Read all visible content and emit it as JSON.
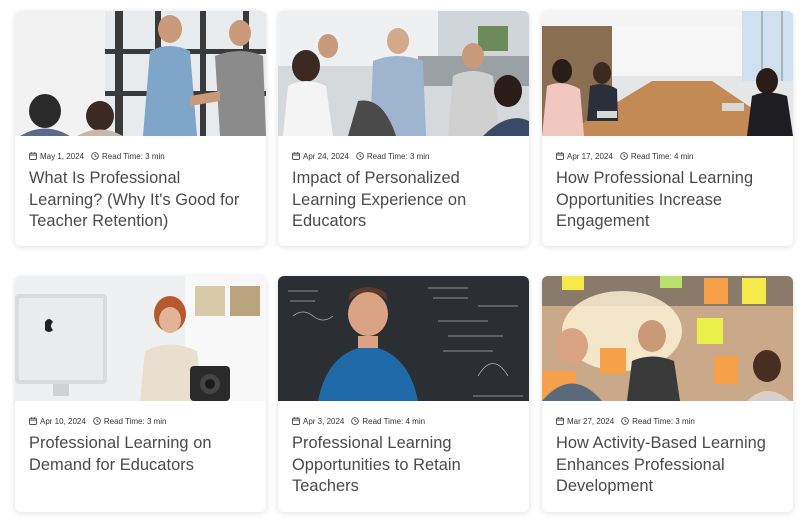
{
  "posts": [
    {
      "date": "May 1, 2024",
      "read_time": "Read Time: 3 min",
      "title": "What Is Professional Learning? (Why It's Good for Teacher Retention)",
      "image": "two-men-shaking-hands-office-photo"
    },
    {
      "date": "Apr 24, 2024",
      "read_time": "Read Time: 3 min",
      "title": "Impact of Personalized Learning Experience on Educators",
      "image": "group-discussion-office-photo"
    },
    {
      "date": "Apr 17, 2024",
      "read_time": "Read Time: 4 min",
      "title": "How Professional Learning Opportunities Increase Engagement",
      "image": "conference-room-meeting-photo"
    },
    {
      "date": "Apr 10, 2024",
      "read_time": "Read Time: 3 min",
      "title": "Professional Learning on Demand for Educators",
      "image": "woman-at-computer-photo"
    },
    {
      "date": "Apr 3, 2024",
      "read_time": "Read Time: 4 min",
      "title": "Professional Learning Opportunities to Retain Teachers",
      "image": "man-at-chalkboard-photo"
    },
    {
      "date": "Mar 27, 2024",
      "read_time": "Read Time: 3 min",
      "title": "How Activity-Based Learning Enhances Professional Development",
      "image": "sticky-notes-brainstorm-photo"
    }
  ],
  "colors": {
    "title": "#4a4a4a",
    "meta": "#333333",
    "card_bg": "#ffffff"
  },
  "icons": {
    "date": "calendar-icon",
    "read_time": "clock-icon"
  }
}
